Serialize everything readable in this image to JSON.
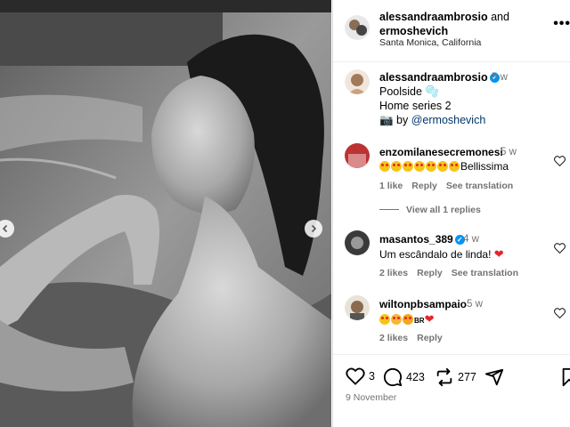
{
  "header": {
    "user1": "alessandraambrosio",
    "conjunction": " and",
    "user2": "ermoshevich",
    "location": "Santa Monica, California",
    "more_label": "⋮"
  },
  "caption": {
    "username": "alessandraambrosio",
    "verified": "✓",
    "time": "5 w",
    "line1": "Poolside ",
    "line1_emoji": "🫧",
    "line2": "Home series 2",
    "credit_icon": "📷",
    "credit_by": " by ",
    "credit_mention": "@ermoshevich"
  },
  "comments": [
    {
      "username": "enzomilanesecremonesi",
      "time": "5 w",
      "text": "Bellissima",
      "emoji_count": 7,
      "likes": "1 like",
      "reply": "Reply",
      "translate": "See translation"
    },
    {
      "username": "masantos_389",
      "verified": "✓",
      "time": "4 w",
      "text": "Um escândalo de linda! ",
      "text_emoji": "❤",
      "likes": "2 likes",
      "reply": "Reply",
      "translate": "See translation"
    },
    {
      "username": "wiltonpbsampaio",
      "time": "5 w",
      "text_suffix": "BR",
      "text_emoji": "❤",
      "likes": "2 likes",
      "reply": "Reply"
    }
  ],
  "view_replies": "View all 1 replies",
  "actions": {
    "likes_count": "3",
    "comments_count": "423",
    "reposts_count": "277"
  },
  "date": "9 November",
  "icons": {
    "header_avatar": "profile-avatar-icon",
    "like": "heart-icon",
    "comment": "comment-bubble-icon",
    "repost": "repost-icon",
    "share": "send-icon",
    "save": "bookmark-icon",
    "prev": "chevron-left-icon",
    "next": "chevron-right-icon"
  },
  "colors": {
    "link": "#00376b",
    "verified": "#0095f6",
    "secondary_text": "#737373",
    "heart": "#e2262a"
  }
}
